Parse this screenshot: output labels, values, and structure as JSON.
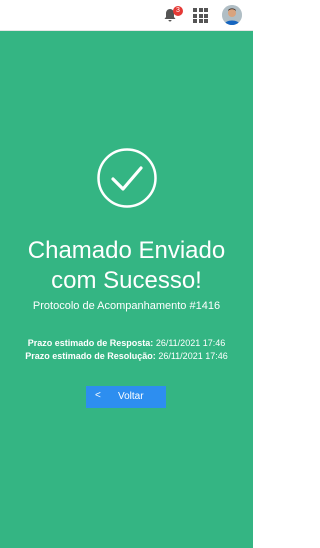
{
  "colors": {
    "background": "#34b583",
    "button": "#2d8ef0",
    "badge": "#e53935",
    "icon_stroke": "#ffffff"
  },
  "header": {
    "notification_count": "3",
    "icons": [
      "bell-icon",
      "apps-grid-icon",
      "avatar"
    ]
  },
  "success": {
    "icon": "check-circle-icon",
    "title_line1": "Chamado Enviado",
    "title_line2": "com Sucesso!",
    "protocol": "Protocolo de Acompanhamento #1416"
  },
  "deadlines": {
    "response_label": "Prazo estimado de Resposta:",
    "response_value": "26/11/2021 17:46",
    "resolution_label": "Prazo estimado de Resolução:",
    "resolution_value": "26/11/2021 17:46"
  },
  "actions": {
    "back_icon": "chevron-left-icon",
    "back_label": "Voltar"
  }
}
